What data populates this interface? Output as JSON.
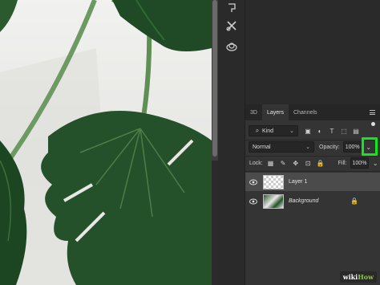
{
  "layers_panel": {
    "tabs": [
      {
        "label": "3D",
        "active": false
      },
      {
        "label": "Layers",
        "active": true
      },
      {
        "label": "Channels",
        "active": false
      }
    ],
    "filter": {
      "label": "Kind"
    },
    "blend_mode": {
      "value": "Normal"
    },
    "opacity": {
      "label": "Opacity:",
      "value": "100%"
    },
    "lock": {
      "label": "Lock:"
    },
    "fill": {
      "label": "Fill:",
      "value": "100%"
    },
    "layers": [
      {
        "name": "Layer 1",
        "selected": true,
        "visible": true,
        "locked": false
      },
      {
        "name": "Background",
        "selected": false,
        "visible": true,
        "locked": true
      }
    ]
  },
  "highlight_color": "#14e61e",
  "watermark": {
    "part1": "wiki",
    "part2": "How"
  }
}
